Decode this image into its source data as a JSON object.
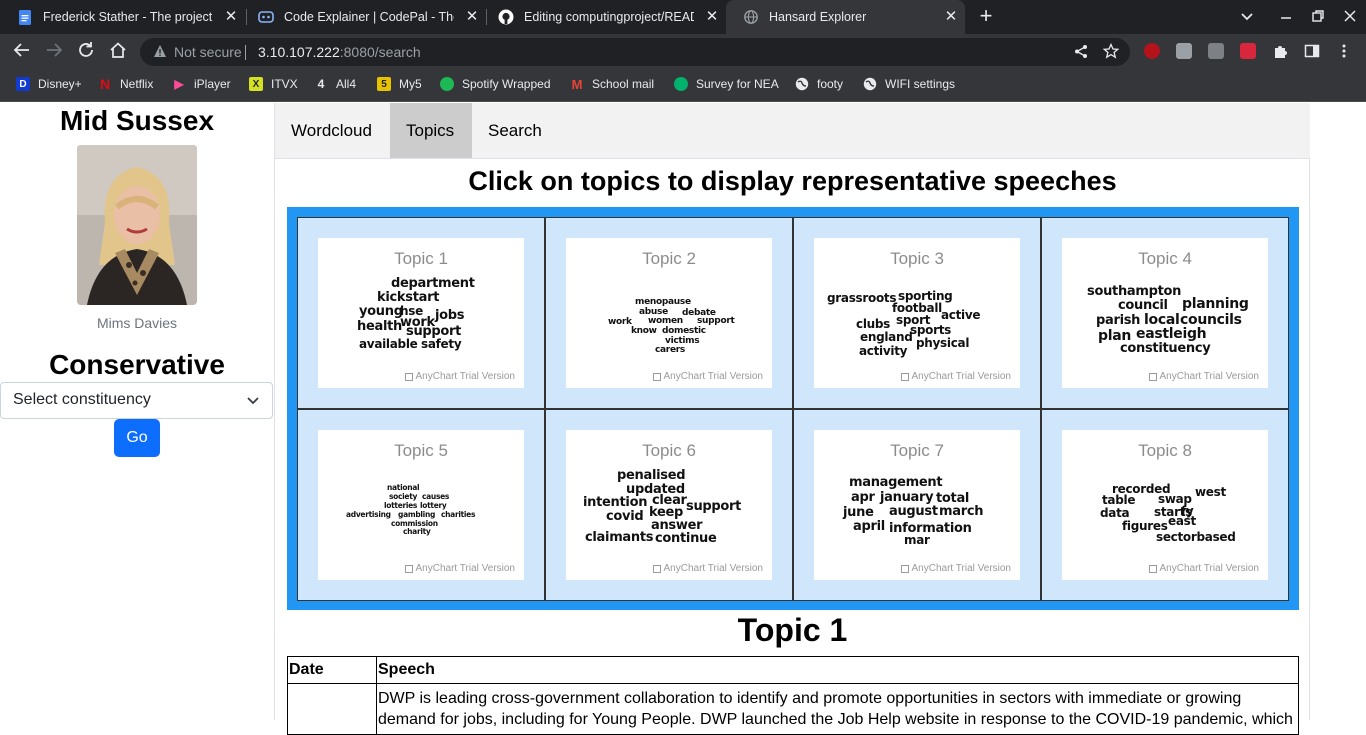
{
  "browser": {
    "tabs": [
      {
        "title": "Frederick Stather - The project - G",
        "icon": "google-docs-icon",
        "color": "#4285f4"
      },
      {
        "title": "Code Explainer | CodePal - The U",
        "icon": "codepal-icon",
        "color": "#8ab4f8"
      },
      {
        "title": "Editing computingproject/READM",
        "icon": "github-icon",
        "color": "#ffffff"
      },
      {
        "title": "Hansard Explorer",
        "icon": "globe-icon",
        "color": "#9aa0a6"
      }
    ],
    "address": {
      "security": "Not secure",
      "host": "3.10.107.222",
      "path": ":8080/search"
    },
    "bookmarks": [
      {
        "label": "Disney+",
        "icon": "disney-icon",
        "color": "#113ccf"
      },
      {
        "label": "Netflix",
        "icon": "netflix-icon",
        "color": "#e50914"
      },
      {
        "label": "iPlayer",
        "icon": "iplayer-icon",
        "color": "#ff4c98"
      },
      {
        "label": "ITVX",
        "icon": "itvx-icon",
        "color": "#d4e022"
      },
      {
        "label": "All4",
        "icon": "all4-icon",
        "color": "#9aa0a6"
      },
      {
        "label": "My5",
        "icon": "my5-icon",
        "color": "#e6c200"
      },
      {
        "label": "Spotify Wrapped",
        "icon": "spotify-icon",
        "color": "#1db954"
      },
      {
        "label": "School mail",
        "icon": "gmail-icon",
        "color": "#ea4335"
      },
      {
        "label": "Survey for NEA",
        "icon": "survey-icon",
        "color": "#00b26b"
      },
      {
        "label": "footy",
        "icon": "globe-icon",
        "color": "#e8eaed"
      },
      {
        "label": "WIFI settings",
        "icon": "globe-icon",
        "color": "#e8eaed"
      }
    ]
  },
  "sidebar": {
    "constituency": "Mid Sussex",
    "mp_name": "Mims Davies",
    "party": "Conservative",
    "select_placeholder": "Select constituency",
    "go_label": "Go"
  },
  "nav": {
    "tabs": [
      "Wordcloud",
      "Topics",
      "Search"
    ],
    "active": "Topics"
  },
  "heading": "Click on topics to display representative speeches",
  "watermark": "AnyChart Trial Version",
  "topics": [
    {
      "title": "Topic 1",
      "words": [
        "department",
        "kickstart",
        "young",
        "hse",
        "jobs",
        "work",
        "health",
        "support",
        "available",
        "safety"
      ]
    },
    {
      "title": "Topic 2",
      "words": [
        "menopause",
        "abuse",
        "debate",
        "work",
        "women",
        "support",
        "know",
        "domestic",
        "victims",
        "carers"
      ]
    },
    {
      "title": "Topic 3",
      "words": [
        "grassroots",
        "sporting",
        "football",
        "active",
        "sport",
        "clubs",
        "england",
        "sports",
        "physical",
        "activity"
      ]
    },
    {
      "title": "Topic 4",
      "words": [
        "southampton",
        "council",
        "planning",
        "parish",
        "local",
        "councils",
        "plan",
        "eastleigh",
        "constituency"
      ]
    },
    {
      "title": "Topic 5",
      "words": [
        "national",
        "society",
        "causes",
        "lotteries",
        "lottery",
        "advertising",
        "gambling",
        "charities",
        "commission",
        "charity"
      ]
    },
    {
      "title": "Topic 6",
      "words": [
        "penalised",
        "updated",
        "intention",
        "clear",
        "support",
        "covid",
        "keep",
        "answer",
        "claimants",
        "continue"
      ]
    },
    {
      "title": "Topic 7",
      "words": [
        "management",
        "apr",
        "january",
        "total",
        "june",
        "august",
        "march",
        "april",
        "information",
        "mar"
      ]
    },
    {
      "title": "Topic 8",
      "words": [
        "recorded",
        "table",
        "swap",
        "west",
        "data",
        "starts",
        "fy",
        "east",
        "figures",
        "sectorbased"
      ]
    }
  ],
  "selected_topic": "Topic 1",
  "table": {
    "headers": [
      "Date",
      "Speech"
    ],
    "rows": [
      {
        "date": "",
        "speech": "DWP is leading cross-government collaboration to identify and promote opportunities in sectors with immediate or growing demand for jobs, including for Young People. DWP launched the Job Help website in response to the COVID-19 pandemic, which"
      }
    ]
  },
  "colors": {
    "accent": "#0d6efd",
    "grid_frame": "#2196f3",
    "cell_bg": "#cfe6fb",
    "active_tab": "#cccccc"
  }
}
